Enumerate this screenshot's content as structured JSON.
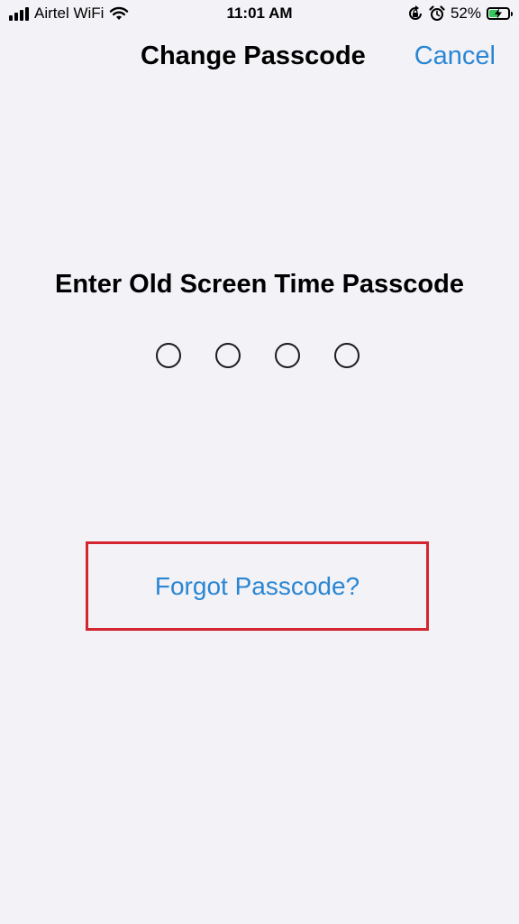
{
  "status_bar": {
    "carrier": "Airtel WiFi",
    "time": "11:01 AM",
    "battery_percent": "52%",
    "battery_level": 0.52,
    "icons": [
      "signal-icon",
      "wifi-icon",
      "orientation-lock-icon",
      "alarm-icon",
      "battery-icon",
      "charging-icon"
    ]
  },
  "nav": {
    "title": "Change Passcode",
    "cancel_label": "Cancel"
  },
  "passcode": {
    "prompt": "Enter Old Screen Time Passcode",
    "digits_total": 4,
    "digits_entered": 0
  },
  "forgot_label": "Forgot Passcode?",
  "colors": {
    "background": "#f2f2f7",
    "accent": "#2a86d3",
    "highlight": "#d32630",
    "battery_fill": "#34c759"
  }
}
